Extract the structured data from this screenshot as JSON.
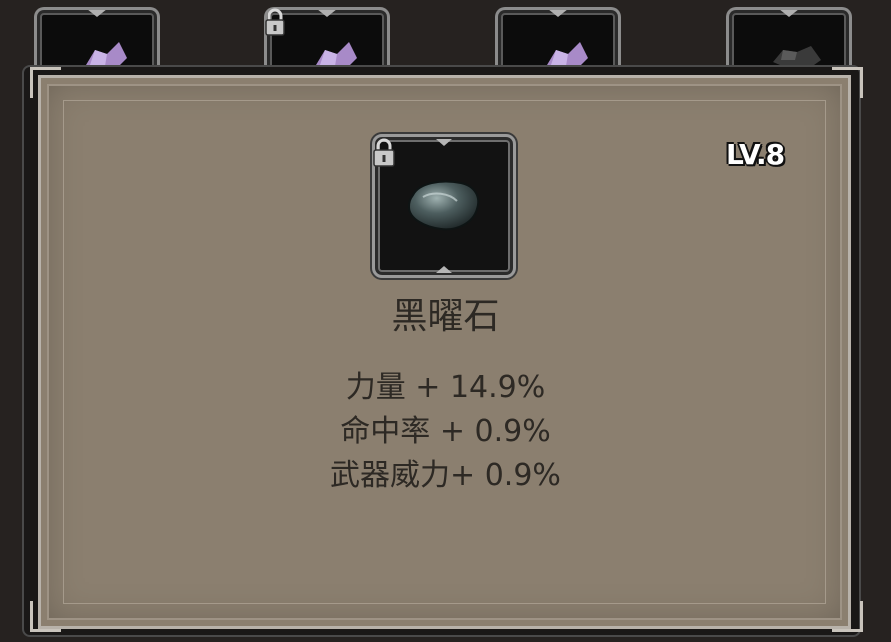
{
  "item": {
    "name": "黑曜石",
    "level": "LV.8",
    "locked": true,
    "icon": "obsidian-stone-icon"
  },
  "stats": [
    "力量 + 14.9%",
    "命中率 + 0.9%",
    "武器威力+ 0.9%"
  ],
  "background_slots": [
    {
      "icon": "amethyst-gem-icon",
      "locked": false
    },
    {
      "icon": "amethyst-gem-icon",
      "locked": true
    },
    {
      "icon": "amethyst-gem-icon",
      "locked": false
    },
    {
      "icon": "dark-stone-icon",
      "locked": false
    }
  ],
  "colors": {
    "panel_background": "#8b7f6f",
    "text": "#2d2924",
    "frame_border": "#b8b2aa",
    "page_background": "#262220"
  }
}
